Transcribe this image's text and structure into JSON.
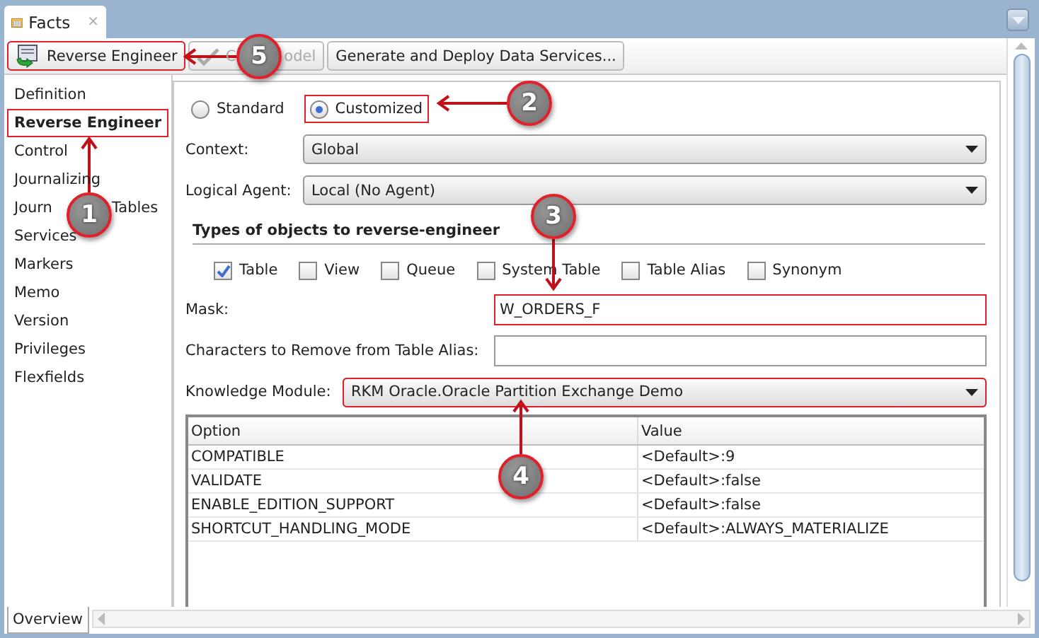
{
  "tab": {
    "label": "Facts",
    "close": "×"
  },
  "toolbar": [
    {
      "label": "Reverse Engineer",
      "kind": "engineer",
      "disabled": false,
      "highlighted": true
    },
    {
      "parts": [
        "C",
        "odel"
      ],
      "kind": "check",
      "disabled": true,
      "highlighted": false
    },
    {
      "label": "Generate and Deploy Data Services...",
      "kind": "plain",
      "disabled": false,
      "highlighted": false
    }
  ],
  "sidebar": {
    "items": [
      {
        "label": "Definition",
        "selected": false,
        "highlighted": false
      },
      {
        "label": "Reverse Engineer",
        "selected": true,
        "highlighted": true
      },
      {
        "label": "Control",
        "selected": false,
        "highlighted": false
      },
      {
        "label": "Journalizing",
        "selected": false,
        "highlighted": false
      },
      {
        "parts": [
          "Journ",
          "Tables"
        ],
        "selected": false,
        "highlighted": false
      },
      {
        "label": "Services",
        "selected": false,
        "highlighted": false
      },
      {
        "label": "Markers",
        "selected": false,
        "highlighted": false
      },
      {
        "label": "Memo",
        "selected": false,
        "highlighted": false
      },
      {
        "label": "Version",
        "selected": false,
        "highlighted": false
      },
      {
        "label": "Privileges",
        "selected": false,
        "highlighted": false
      },
      {
        "label": "Flexfields",
        "selected": false,
        "highlighted": false
      }
    ]
  },
  "mode": [
    {
      "label": "Standard",
      "selected": false,
      "highlighted": false
    },
    {
      "label": "Customized",
      "selected": true,
      "highlighted": true
    }
  ],
  "selectors": [
    {
      "label": "Context:",
      "value": "Global"
    },
    {
      "label": "Logical Agent:",
      "value": "Local (No Agent)"
    }
  ],
  "section_title": "Types of objects to reverse-engineer",
  "object_types": [
    {
      "label": "Table",
      "checked": true
    },
    {
      "label": "View",
      "checked": false
    },
    {
      "label": "Queue",
      "checked": false
    },
    {
      "label": "System Table",
      "checked": false
    },
    {
      "label": "Table Alias",
      "checked": false
    },
    {
      "label": "Synonym",
      "checked": false
    }
  ],
  "filters": [
    {
      "kind": "text",
      "label": "Mask:",
      "value": "W_ORDERS_F",
      "highlighted": true
    },
    {
      "kind": "text",
      "label": "Characters to Remove from Table Alias:",
      "highlighted": false
    },
    {
      "kind": "combo",
      "label": "Knowledge Module:",
      "value": "RKM Oracle.Oracle Partition Exchange Demo",
      "highlighted": true
    }
  ],
  "options_table": {
    "columns": [
      "Option",
      "Value"
    ],
    "rows": [
      [
        "COMPATIBLE",
        "<Default>:9"
      ],
      [
        "VALIDATE",
        "<Default>:false"
      ],
      [
        "ENABLE_EDITION_SUPPORT",
        "<Default>:false"
      ],
      [
        "SHORTCUT_HANDLING_MODE",
        "<Default>:ALWAYS_MATERIALIZE"
      ]
    ]
  },
  "bottom_tab": {
    "label": "Overview",
    "selected": true
  },
  "annotations": [
    {
      "number": "1"
    },
    {
      "number": "2"
    },
    {
      "number": "3"
    },
    {
      "number": "4"
    },
    {
      "number": "5"
    }
  ]
}
